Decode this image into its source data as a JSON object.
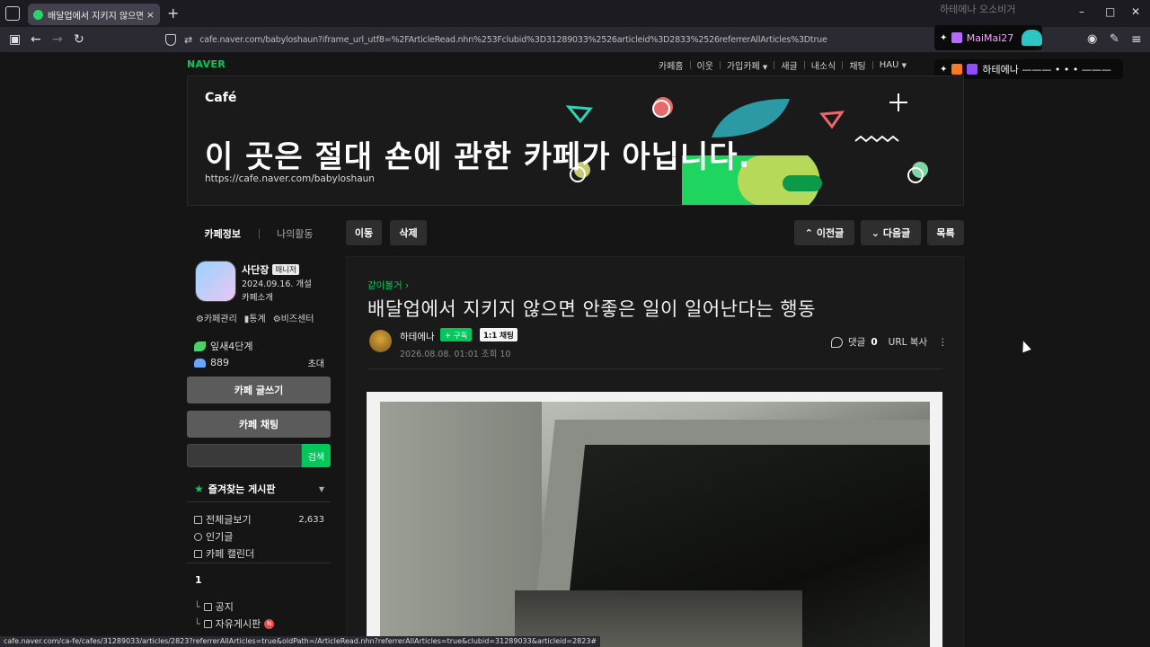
{
  "browser": {
    "tab_title": "배달업에서 지키지 않으면 안좋",
    "tab_close": "×",
    "new_tab": "+",
    "url": "cafe.naver.com/babyloshaun?iframe_url_utf8=%2FArticleRead.nhn%253Fclubid%3D31289033%2526articleid%3D2833%2526referrerAllArticles%3Dtrue",
    "status_url": "cafe.naver.com/ca-fe/cafes/31289033/articles/2823?referrerAllArticles=true&oldPath=/ArticleRead.nhn?referrerAllArticles=true&clubid=31289033&articleid=2823#"
  },
  "overlay": {
    "faded_text": "하테에나 오소비거",
    "user1": "MaiMai27",
    "user2_msg": "하테에나 ——— • • • ———"
  },
  "site": {
    "logo": "NAVER",
    "menu": [
      "카페홈",
      "이웃",
      "가입카페",
      "새글",
      "내소식",
      "채팅",
      "HAU"
    ]
  },
  "banner": {
    "cafe_label": "Café",
    "headline": "이 곳은 절대 숀에 관한 카페가 아닙니다.",
    "url": "https://cafe.naver.com/babyloshaun"
  },
  "sidebar": {
    "tab_info": "카페정보",
    "tab_activity": "나의활동",
    "owner_name": "사단장",
    "manager_badge": "매니저",
    "founded": "2024.09.16. 개설",
    "intro": "카페소개",
    "tools": [
      "카페관리",
      "통계",
      "비즈센터"
    ],
    "level": "잎새4단계",
    "members": "889",
    "invite": "초대",
    "write_btn": "카페 글쓰기",
    "chat_btn": "카페 채팅",
    "search_btn": "검색",
    "favorites_title": "즐겨찾는 게시판",
    "menu": [
      {
        "label": "전체글보기",
        "count": "2,633"
      },
      {
        "label": "인기글",
        "count": ""
      },
      {
        "label": "카페 캘린더",
        "count": ""
      }
    ],
    "group_num": "1",
    "boards": [
      {
        "label": "공지"
      },
      {
        "label": "자유게시판",
        "new": "N"
      }
    ]
  },
  "toolbar": {
    "move": "이동",
    "delete": "삭제",
    "prev": "이전글",
    "next": "다음글",
    "list": "목록"
  },
  "article": {
    "board": "같이볼거",
    "title": "배달업에서 지키지 않으면 안좋은 일이 일어난다는 행동",
    "author": "하테에나",
    "subscribe": "+ 구독",
    "chat": "1:1 채팅",
    "meta": "2026.08.08. 01:01   조회 10",
    "comments_label": "댓글",
    "comments_count": "0",
    "url_copy": "URL 복사",
    "more": "⋮"
  }
}
